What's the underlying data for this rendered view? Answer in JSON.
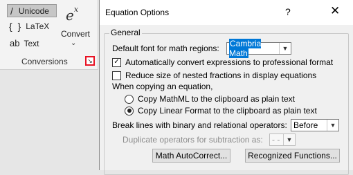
{
  "ribbon": {
    "unicode_glyph": "/",
    "unicode_label": "Unicode",
    "latex_glyph": "{ }",
    "latex_label": "LaTeX",
    "text_glyph": "ab",
    "text_label": "Text",
    "ex_base": "e",
    "ex_sup": "x",
    "convert_label": "Convert",
    "convert_chevron": "⌄",
    "group_label": "Conversions",
    "launcher_glyph": "↘"
  },
  "dialog": {
    "title": "Equation Options",
    "help_glyph": "?",
    "close_glyph": "✕",
    "group_label": "General",
    "default_font_label": "Default font for math regions:",
    "default_font_value": "Cambria Math",
    "auto_convert_label": "Automatically convert expressions to professional format",
    "auto_convert_checked": true,
    "reduce_size_label": "Reduce size of nested fractions in display equations",
    "reduce_size_checked": false,
    "copy_heading": "When copying an equation,",
    "copy_mathml_label": "Copy MathML to the clipboard as plain text",
    "copy_linear_label": "Copy Linear Format to the clipboard as plain text",
    "copy_selected": "linear",
    "break_lines_label": "Break lines with binary and relational operators:",
    "break_lines_value": "Before",
    "duplicate_label": "Duplicate operators for subtraction as:",
    "duplicate_value": "- -",
    "autocorrect_button": "Math AutoCorrect...",
    "recognized_button": "Recognized Functions..."
  }
}
